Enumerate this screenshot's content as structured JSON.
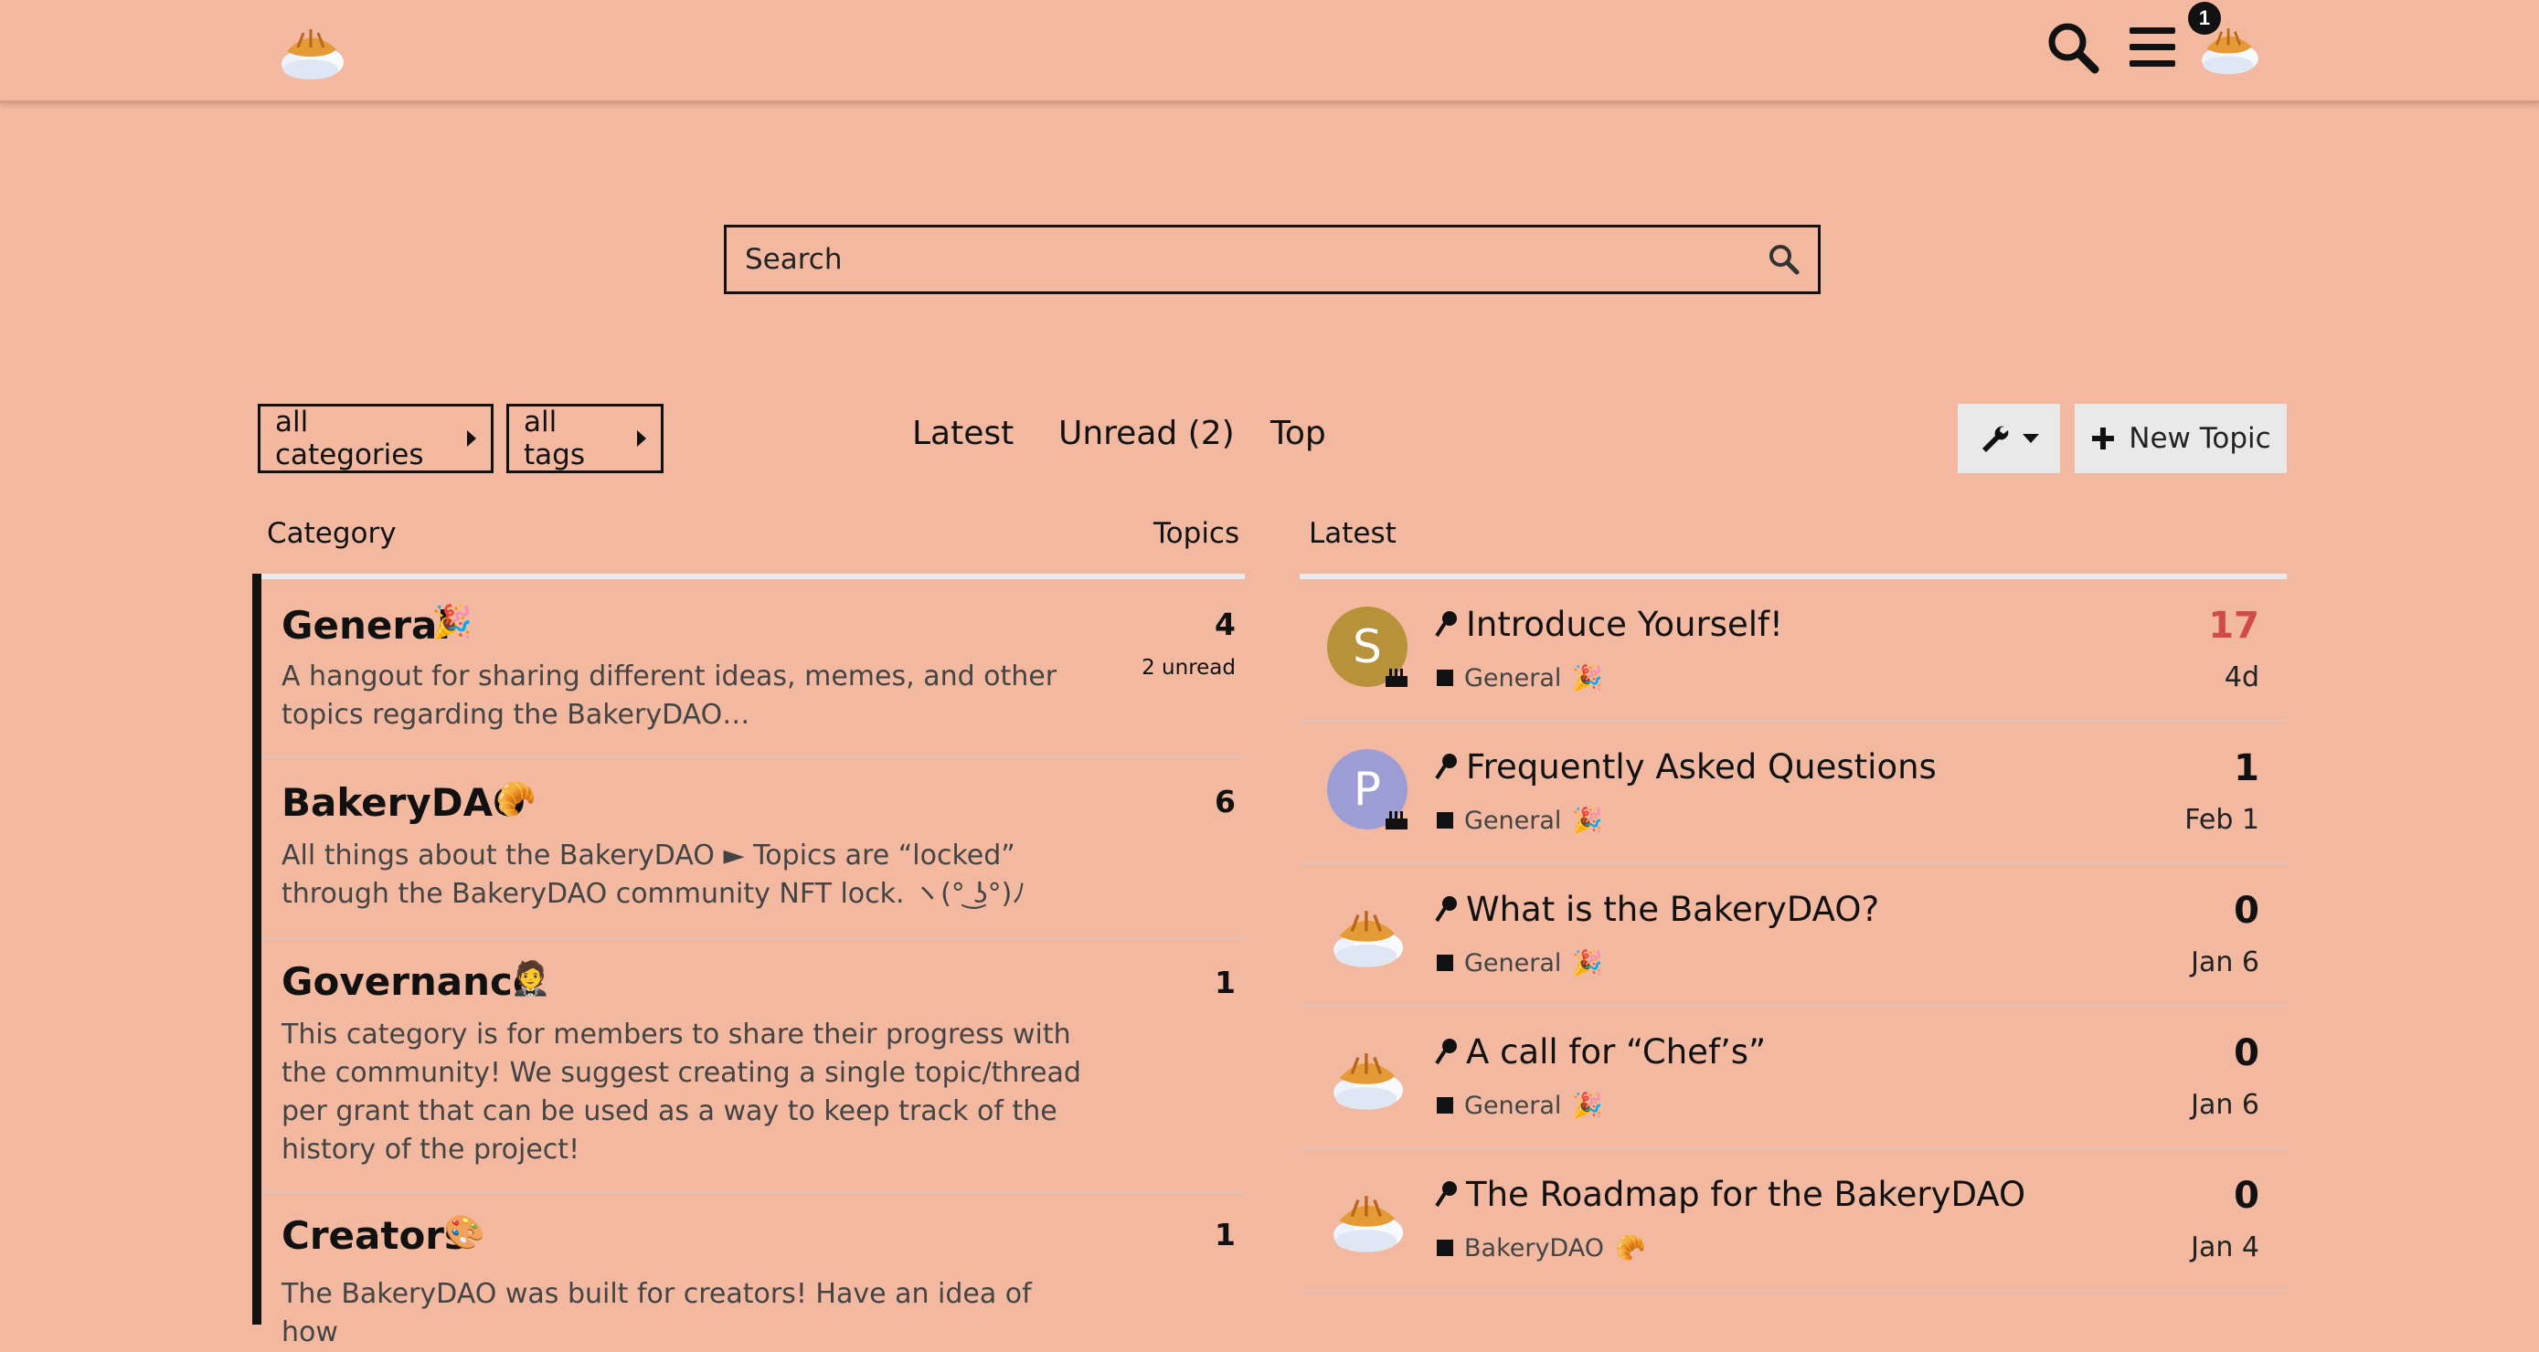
{
  "header": {
    "notification_count": "1",
    "logo_icon": "croissant-cloud-logo",
    "icons": [
      "search-icon",
      "hamburger-menu-icon",
      "user-avatar"
    ]
  },
  "search": {
    "placeholder": "Search"
  },
  "filters": {
    "categories_label": "all categories",
    "tags_label": "all tags"
  },
  "nav": {
    "latest": "Latest",
    "unread": "Unread (2)",
    "top": "Top"
  },
  "actions": {
    "new_topic": "New Topic"
  },
  "columns": {
    "category": "Category",
    "topics": "Topics",
    "latest": "Latest"
  },
  "categories": [
    {
      "name": "General",
      "emoji": "🎉",
      "description": "A hangout for sharing different ideas, memes, and other topics regarding the BakeryDAO…",
      "topics": "4",
      "unread": "2 unread"
    },
    {
      "name": "BakeryDAO",
      "emoji": "🥐",
      "description": "All things about the BakeryDAO ► Topics are “locked” through the BakeryDAO community NFT lock. ヽ(° ͜ʖ°)ﾉ",
      "topics": "6"
    },
    {
      "name": "Governance",
      "emoji": "🤵",
      "description": "This category is for members to share their progress with the community! We suggest creating a single topic/thread per grant that can be used as a way to keep track of the history of the project!",
      "topics": "1"
    },
    {
      "name": "Creators",
      "emoji": "🎨",
      "description": "The BakeryDAO was built for creators! Have an idea of how",
      "topics": "1"
    }
  ],
  "topics": [
    {
      "title": "Introduce Yourself!",
      "category": "General",
      "category_emoji": "🎉",
      "replies": "17",
      "age": "4d",
      "avatar_letter": "S",
      "avatar_color": "#b8923a"
    },
    {
      "title": "Frequently Asked Questions",
      "category": "General",
      "category_emoji": "🎉",
      "replies": "1",
      "age": "Feb 1",
      "avatar_letter": "P",
      "avatar_color": "#9d9dd6"
    },
    {
      "title": "What is the BakeryDAO?",
      "category": "General",
      "category_emoji": "🎉",
      "replies": "0",
      "age": "Jan 6"
    },
    {
      "title": "A call for “Chef’s”",
      "category": "General",
      "category_emoji": "🎉",
      "replies": "0",
      "age": "Jan 6"
    },
    {
      "title": "The Roadmap for the BakeryDAO",
      "category": "BakeryDAO",
      "category_emoji": "🥐",
      "replies": "0",
      "age": "Jan 4"
    }
  ],
  "colors": {
    "background": "#f2b9a0",
    "hot_reply": "#d04a4a",
    "button_bg": "#e9e9e9"
  }
}
